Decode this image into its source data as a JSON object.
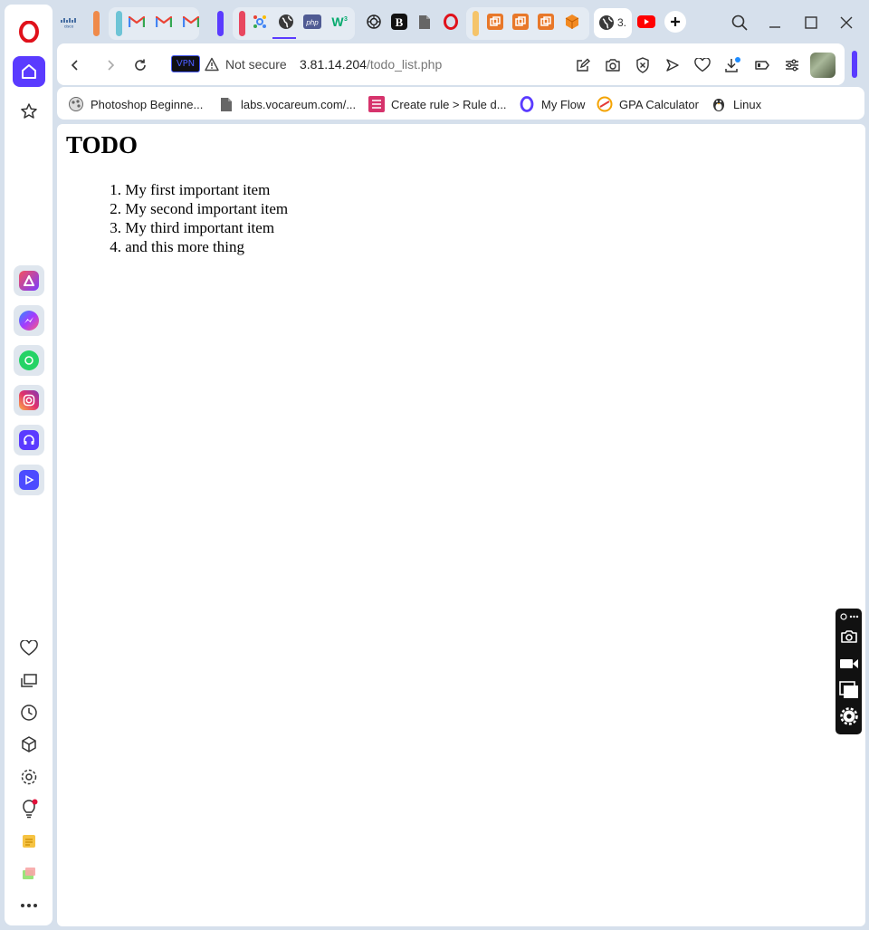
{
  "browser": {
    "active_tab_label": "3.",
    "vpn_label": "VPN",
    "security_text": "Not secure",
    "url_host": "3.81.14.204",
    "url_path": "/todo_list.php",
    "accent_color": "#5a3bff"
  },
  "tabs": [
    {
      "icon": "cisco-icon"
    },
    {
      "icon": "gmail-icon"
    },
    {
      "icon": "gmail-icon"
    },
    {
      "icon": "gmail-icon"
    },
    {
      "icon": "colorful-icon"
    },
    {
      "icon": "globe-icon"
    },
    {
      "icon": "php-icon"
    },
    {
      "icon": "w3schools-icon"
    },
    {
      "icon": "chatgpt-icon"
    },
    {
      "icon": "b-icon"
    },
    {
      "icon": "page-icon"
    },
    {
      "icon": "opera-icon"
    },
    {
      "icon": "box-icon"
    },
    {
      "icon": "box-icon"
    },
    {
      "icon": "box-icon"
    },
    {
      "icon": "cube-icon"
    },
    {
      "icon": "globe-icon"
    },
    {
      "icon": "youtube-icon"
    }
  ],
  "bookmarks": [
    {
      "label": "Photoshop Beginne...",
      "icon": "photoshop-icon"
    },
    {
      "label": "labs.vocareum.com/...",
      "icon": "page-icon"
    },
    {
      "label": "Create rule > Rule d...",
      "icon": "rule-icon"
    },
    {
      "label": "My Flow",
      "icon": "opera-icon"
    },
    {
      "label": "GPA Calculator",
      "icon": "calculator-icon"
    },
    {
      "label": "Linux",
      "icon": "linux-icon"
    }
  ],
  "page": {
    "title": "TODO",
    "items": [
      {
        "num": "1.",
        "text": "My first important item"
      },
      {
        "num": "2.",
        "text": "My second important item"
      },
      {
        "num": "3.",
        "text": "My third important item"
      },
      {
        "num": "4.",
        "text": "and this more thing"
      }
    ]
  }
}
